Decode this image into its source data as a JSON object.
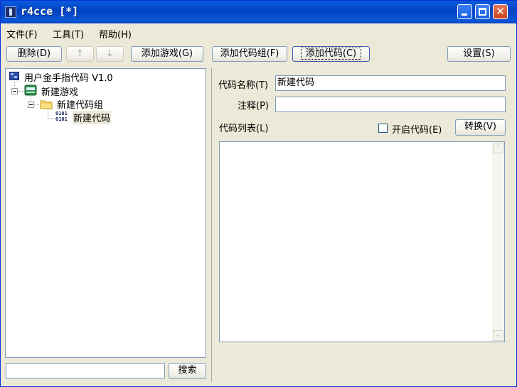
{
  "window": {
    "title": "r4cce [*]"
  },
  "menu": [
    {
      "label": "文件(F)"
    },
    {
      "label": "工具(T)"
    },
    {
      "label": "帮助(H)"
    }
  ],
  "toolbar": {
    "delete_label": "删除(D)",
    "up_label": "↑",
    "down_label": "↓",
    "add_game_label": "添加游戏(G)",
    "add_group_label": "添加代码组(F)",
    "add_code_label": "添加代码(C)",
    "settings_label": "设置(S)"
  },
  "tree": {
    "root": {
      "label": "用户金手指代码 V1.0",
      "icon": "database-icon"
    },
    "game": {
      "label": "新建游戏",
      "icon": "cartridge-icon"
    },
    "group": {
      "label": "新建代码组",
      "icon": "folder-icon"
    },
    "code": {
      "label": "新建代码",
      "icon": "binary-code-icon",
      "icon_text": "0101\n0101"
    }
  },
  "search": {
    "value": "",
    "button_label": "搜索"
  },
  "details": {
    "name_label": "代码名称(T)",
    "name_value": "新建代码",
    "note_label": "注释(P)",
    "note_value": "",
    "code_list_label": "代码列表(L)",
    "enable_label": "开启代码(E)",
    "enable_checked": false,
    "convert_label": "转换(V)"
  },
  "colors": {
    "titlebar": "#0a5bdc",
    "window_bg": "#ece9d8",
    "border": "#7f9db9"
  }
}
